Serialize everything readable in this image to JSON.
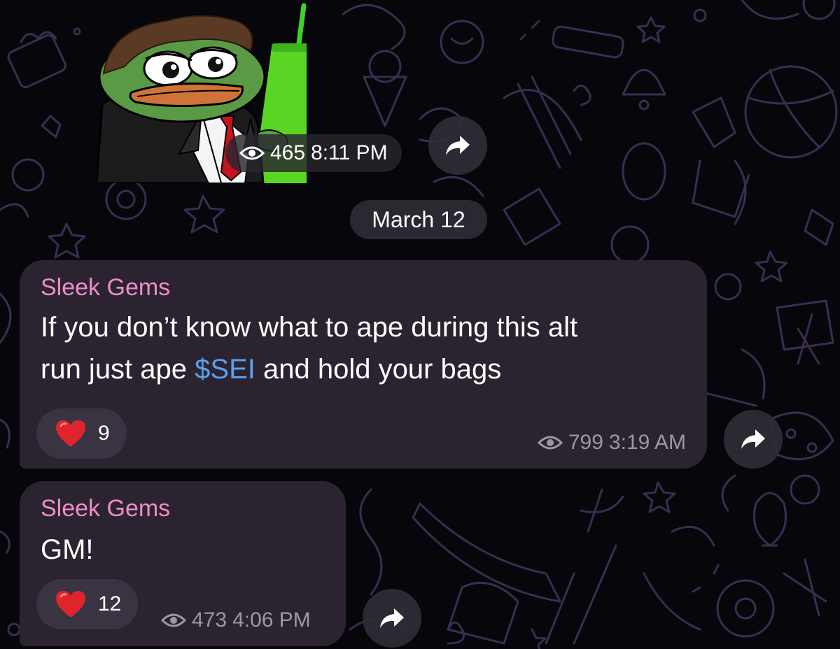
{
  "colors": {
    "background": "#07060a",
    "doodle": "#3a2d52",
    "bubble": "#2b2430",
    "sender": "#ee8dc6",
    "link": "#5b9ff0",
    "heart": "#e0242c",
    "meta_text": "#9d96a3"
  },
  "sticker": {
    "icon": "pepe-frog-sticker",
    "views": "465",
    "time": "8:11 PM"
  },
  "date_separator": "March 12",
  "messages": [
    {
      "sender": "Sleek Gems",
      "text_line1": "If you don’t know what to ape during this alt",
      "text_line2_before": "run just ape ",
      "link": "$SEI",
      "text_line2_after": " and hold your bags",
      "reaction_icon": "heart-icon",
      "reaction_count": "9",
      "views": "799",
      "time": "3:19 AM"
    },
    {
      "sender": "Sleek Gems",
      "text": "GM!",
      "reaction_icon": "heart-icon",
      "reaction_count": "12",
      "views": "473",
      "time": "4:06 PM"
    }
  ]
}
